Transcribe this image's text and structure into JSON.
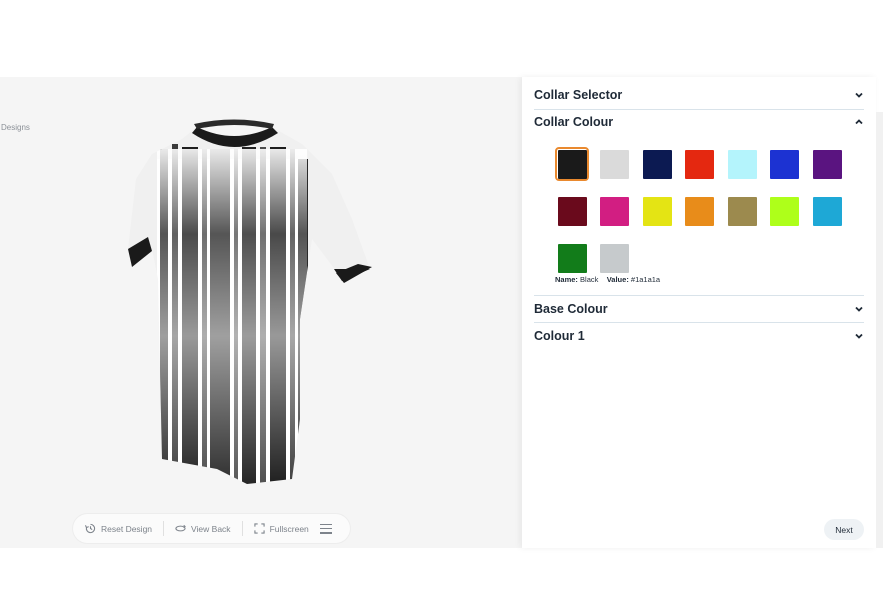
{
  "breadcrumb": "Designs",
  "toolbar": {
    "reset_label": "Reset Design",
    "reset_icon": "history-icon",
    "view_back_label": "View Back",
    "view_back_icon": "rotate-icon",
    "fullscreen_label": "Fullscreen",
    "fullscreen_icon": "expand-icon",
    "menu_icon": "hamburger-icon"
  },
  "panel": {
    "sections": [
      {
        "title": "Collar Selector",
        "expanded": false
      },
      {
        "title": "Collar Colour",
        "expanded": true
      },
      {
        "title": "Base Colour",
        "expanded": false
      },
      {
        "title": "Colour 1",
        "expanded": false
      }
    ],
    "swatches": [
      {
        "color": "#1a1a1a",
        "selected": true
      },
      {
        "color": "#dadada"
      },
      {
        "color": "#0c1a52"
      },
      {
        "color": "#e42810"
      },
      {
        "color": "#b4f4fc"
      },
      {
        "color": "#1c32d2"
      },
      {
        "color": "#5a1480"
      },
      {
        "color": "#6a0a1c"
      },
      {
        "color": "#d21e82"
      },
      {
        "color": "#e4e414"
      },
      {
        "color": "#e88c1a"
      },
      {
        "color": "#9c8a4e"
      },
      {
        "color": "#aeff1a"
      },
      {
        "color": "#1ea8d6"
      },
      {
        "color": "#127c1a"
      },
      {
        "color": "#c6cacc"
      }
    ],
    "selected_name_label": "Name:",
    "selected_name": "Black",
    "selected_value_label": "Value:",
    "selected_value": "#1a1a1a",
    "next_label": "Next"
  },
  "colors": {
    "accent_selected": "#e9892e",
    "heading": "#1f2a37",
    "divider": "#d9e3ea"
  }
}
